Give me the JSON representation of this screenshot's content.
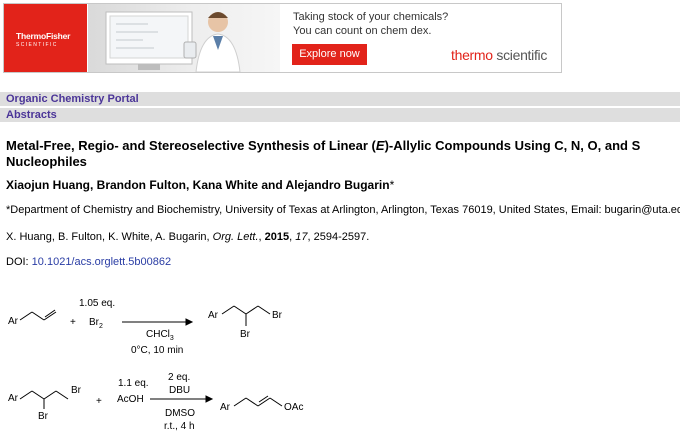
{
  "ad": {
    "brand_line1": "ThermoFisher",
    "brand_line2": "SCIENTIFIC",
    "headline_line1": "Taking stock of your chemicals?",
    "headline_line2": "You can count on chem dex.",
    "cta_label": "Explore now",
    "logo_word1": "thermo",
    "logo_word2": "scientific"
  },
  "breadcrumb": {
    "portal": "Organic Chemistry Portal",
    "section": "Abstracts"
  },
  "article": {
    "title_part1": "Metal-Free, Regio- and Stereoselective Synthesis of Linear (",
    "title_italic": "E",
    "title_part2": ")-Allylic Compounds Using C, N, O, and S Nucleophiles",
    "authors": "Xiaojun Huang, Brandon Fulton, Kana White and Alejandro Bugarin",
    "authors_mark": "*",
    "affiliation": "*Department of Chemistry and Biochemistry, University of Texas at Arlington, Arlington, Texas 76019, United States, Email: bugarin@uta.edu",
    "citation": {
      "authors": "X. Huang, B. Fulton, K. White, A. Bugarin, ",
      "journal": "Org. Lett.",
      "year": "2015",
      "volume": "17",
      "pages": ", 2594-2597."
    },
    "doi_label": "DOI: ",
    "doi_value": "10.1021/acs.orglett.5b00862"
  },
  "scheme": {
    "step1": {
      "substrate_label": "Ar",
      "plus": "+",
      "reagent_amount": "1.05 eq.",
      "reagent": "Br",
      "reagent_sub": "2",
      "solvent": "CHCl",
      "solvent_sub": "3",
      "conditions": "0°C, 10 min",
      "product_ar": "Ar",
      "product_br1": "Br",
      "product_br2": "Br"
    },
    "step2": {
      "substrate_ar": "Ar",
      "substrate_br1": "Br",
      "substrate_br2": "Br",
      "plus": "+",
      "reagent_amount": "1.1 eq.",
      "reagent": "AcOH",
      "base_amount": "2 eq.",
      "base": "DBU",
      "solvent": "DMSO",
      "conditions": "r.t., 4 h",
      "product_ar": "Ar",
      "product_group": "OAc"
    }
  }
}
